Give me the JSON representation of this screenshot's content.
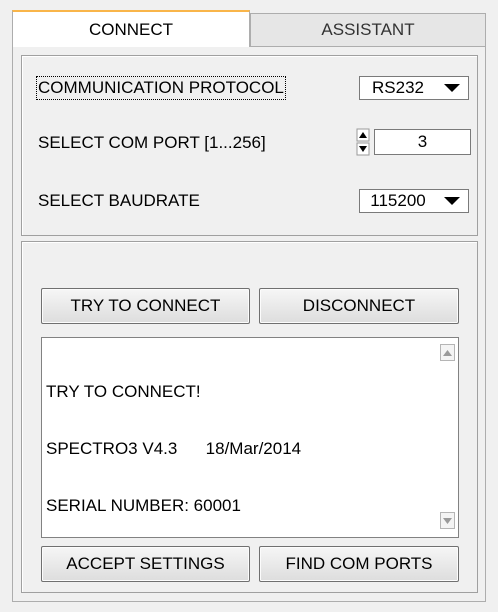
{
  "tabs": [
    {
      "label": "CONNECT",
      "active": true
    },
    {
      "label": "ASSISTANT",
      "active": false
    }
  ],
  "settings": {
    "protocol": {
      "label": "COMMUNICATION PROTOCOL",
      "value": "RS232"
    },
    "com_port": {
      "label": "SELECT COM PORT [1...256]",
      "value": "3"
    },
    "baudrate": {
      "label": "SELECT BAUDRATE",
      "value": "115200"
    }
  },
  "actions": {
    "try_connect": "TRY TO CONNECT",
    "disconnect": "DISCONNECT",
    "accept_settings": "ACCEPT SETTINGS",
    "find_com_ports": "FIND COM PORTS"
  },
  "log": {
    "lines": [
      "TRY TO CONNECT!",
      "SPECTRO3 V4.3      18/Mar/2014",
      "SERIAL NUMBER: 60001"
    ]
  },
  "colors": {
    "active_tab_accent": "#f9b54a",
    "background": "#f0f0f0"
  }
}
